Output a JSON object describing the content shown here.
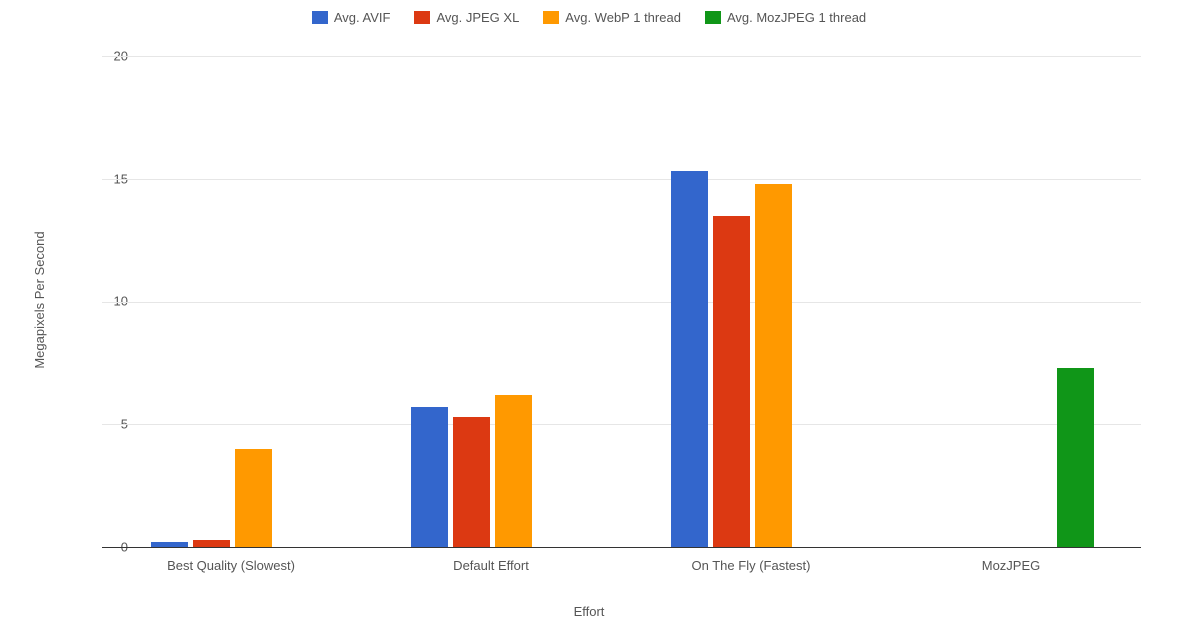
{
  "chart_data": {
    "type": "bar",
    "title": "",
    "xlabel": "Effort",
    "ylabel": "Megapixels Per Second",
    "ylim": [
      0,
      20
    ],
    "yticks": [
      0,
      5,
      10,
      15,
      20
    ],
    "categories": [
      "Best Quality (Slowest)",
      "Default Effort",
      "On The Fly (Fastest)",
      "MozJPEG"
    ],
    "series": [
      {
        "name": "Avg. AVIF",
        "color": "#3366cc",
        "values": [
          0.2,
          5.7,
          15.3,
          null
        ]
      },
      {
        "name": "Avg. JPEG XL",
        "color": "#dc3912",
        "values": [
          0.3,
          5.3,
          13.5,
          null
        ]
      },
      {
        "name": "Avg. WebP 1 thread",
        "color": "#ff9900",
        "values": [
          4.0,
          6.2,
          14.8,
          null
        ]
      },
      {
        "name": "Avg. MozJPEG 1 thread",
        "color": "#109618",
        "values": [
          null,
          null,
          null,
          7.3
        ]
      }
    ]
  },
  "legend": {
    "s0": "Avg. AVIF",
    "s1": "Avg. JPEG XL",
    "s2": "Avg. WebP 1 thread",
    "s3": "Avg. MozJPEG 1 thread"
  },
  "axes": {
    "ylabel": "Megapixels Per Second",
    "xlabel": "Effort",
    "y0": "0",
    "y5": "5",
    "y10": "10",
    "y15": "15",
    "y20": "20",
    "c0": "Best Quality (Slowest)",
    "c1": "Default Effort",
    "c2": "On The Fly (Fastest)",
    "c3": "MozJPEG"
  },
  "colors": {
    "s0": "#3366cc",
    "s1": "#dc3912",
    "s2": "#ff9900",
    "s3": "#109618"
  }
}
